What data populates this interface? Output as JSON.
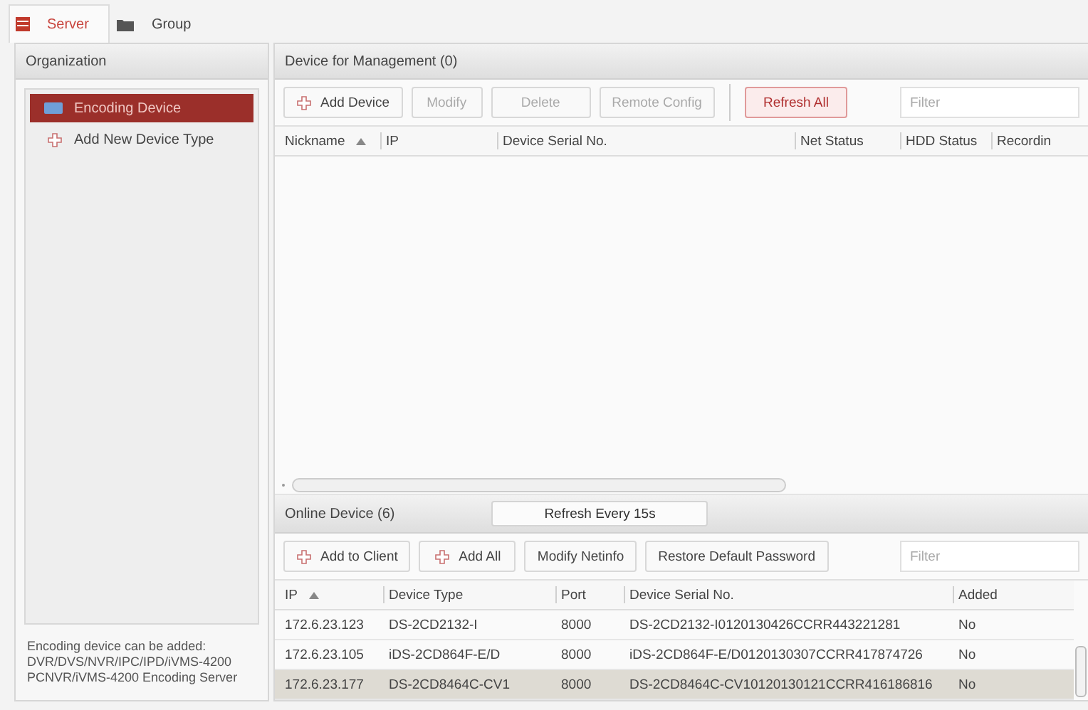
{
  "tabs": [
    {
      "label": "Server",
      "selected": true
    },
    {
      "label": "Group",
      "selected": false
    }
  ],
  "organization": {
    "title": "Organization",
    "items": [
      {
        "label": "Encoding Device",
        "selected": true
      },
      {
        "label": "Add New Device Type",
        "selected": false
      }
    ],
    "note": [
      "Encoding device can be added:",
      "DVR/DVS/NVR/IPC/IPD/iVMS-4200",
      "PCNVR/iVMS-4200 Encoding Server"
    ]
  },
  "management": {
    "title": "Device for Management (0)",
    "buttons": [
      {
        "label": "Add Device",
        "kind": "add",
        "disabled": false
      },
      {
        "label": "Modify",
        "kind": "plain",
        "disabled": true
      },
      {
        "label": "Delete",
        "kind": "plain",
        "disabled": true
      },
      {
        "label": "Remote Config",
        "kind": "plain",
        "disabled": true
      },
      {
        "label": "Refresh All",
        "kind": "alert",
        "disabled": false
      }
    ],
    "filter": {
      "placeholder": "Filter"
    },
    "columns": [
      {
        "label": "Nickname",
        "sorted": true
      },
      {
        "label": "IP",
        "sorted": false
      },
      {
        "label": "Device Serial No.",
        "sorted": false
      },
      {
        "label": "Net Status",
        "sorted": false
      },
      {
        "label": "HDD Status",
        "sorted": false
      },
      {
        "label": "Recordin",
        "sorted": false
      }
    ]
  },
  "online": {
    "title": "Online Device (6)",
    "refresh": "Refresh Every 15s",
    "buttons": [
      {
        "label": "Add to Client",
        "kind": "add",
        "disabled": false
      },
      {
        "label": "Add All",
        "kind": "add",
        "disabled": false
      },
      {
        "label": "Modify Netinfo",
        "kind": "plain",
        "disabled": false
      },
      {
        "label": "Restore Default Password",
        "kind": "plain",
        "disabled": false
      }
    ],
    "filter": {
      "placeholder": "Filter"
    },
    "columns": [
      {
        "label": "IP",
        "sorted": true
      },
      {
        "label": "Device Type",
        "sorted": false
      },
      {
        "label": "Port",
        "sorted": false
      },
      {
        "label": "Device Serial No.",
        "sorted": false
      },
      {
        "label": "Added",
        "sorted": false
      }
    ],
    "rows": [
      {
        "cells": [
          "172.6.23.123",
          "DS-2CD2132-I",
          "8000",
          "DS-2CD2132-I0120130426CCRR443221281",
          "No"
        ],
        "selected": false
      },
      {
        "cells": [
          "172.6.23.105",
          "iDS-2CD864F-E/D",
          "8000",
          "iDS-2CD864F-E/D0120130307CCRR417874726",
          "No"
        ],
        "selected": false
      },
      {
        "cells": [
          "172.6.23.177",
          "DS-2CD8464C-CV1",
          "8000",
          "DS-2CD8464C-CV10120130121CCRR416186816",
          "No"
        ],
        "selected": true
      }
    ]
  }
}
